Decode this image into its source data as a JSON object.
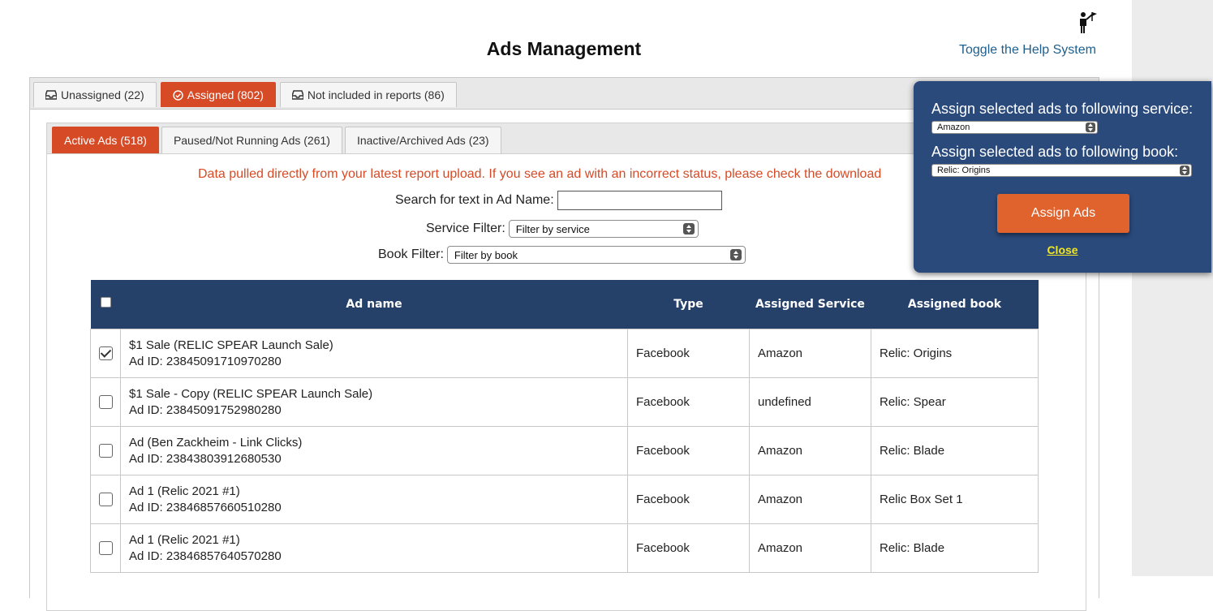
{
  "page": {
    "title": "Ads Management",
    "help_link": "Toggle the Help System"
  },
  "outer_tabs": [
    {
      "label": "Unassigned (22)",
      "icon": "inbox-icon",
      "active": false
    },
    {
      "label": "Assigned (802)",
      "icon": "check-circle-icon",
      "active": true
    },
    {
      "label": "Not included in reports (86)",
      "icon": "inbox-icon",
      "active": false
    }
  ],
  "inner_tabs": [
    {
      "label": "Active Ads (518)",
      "active": true
    },
    {
      "label": "Paused/Not Running Ads (261)",
      "active": false
    },
    {
      "label": "Inactive/Archived Ads (23)",
      "active": false
    }
  ],
  "notice": "Data pulled directly from your latest report upload. If you see an ad with an incorrect status, please check the download",
  "filters": {
    "search_label": "Search for text in Ad Name:",
    "search_value": "",
    "service_label": "Service Filter:",
    "service_value": "Filter by service",
    "book_label": "Book Filter:",
    "book_value": "Filter by book"
  },
  "table": {
    "columns": [
      "Ad name",
      "Type",
      "Assigned Service",
      "Assigned book"
    ],
    "rows": [
      {
        "checked": true,
        "name": "$1 Sale (RELIC SPEAR Launch Sale)",
        "ad_id": "Ad ID: 23845091710970280",
        "type": "Facebook",
        "service": "Amazon",
        "book": "Relic: Origins"
      },
      {
        "checked": false,
        "name": "$1 Sale - Copy (RELIC SPEAR Launch Sale)",
        "ad_id": "Ad ID: 23845091752980280",
        "type": "Facebook",
        "service": "undefined",
        "book": "Relic: Spear"
      },
      {
        "checked": false,
        "name": "Ad (Ben Zackheim - Link Clicks)",
        "ad_id": "Ad ID: 23843803912680530",
        "type": "Facebook",
        "service": "Amazon",
        "book": "Relic: Blade"
      },
      {
        "checked": false,
        "name": "Ad 1 (Relic 2021 #1)",
        "ad_id": "Ad ID: 23846857660510280",
        "type": "Facebook",
        "service": "Amazon",
        "book": "Relic Box Set 1"
      },
      {
        "checked": false,
        "name": "Ad 1 (Relic 2021 #1)",
        "ad_id": "Ad ID: 23846857640570280",
        "type": "Facebook",
        "service": "Amazon",
        "book": "Relic: Blade"
      }
    ]
  },
  "assign_popup": {
    "service_label": "Assign selected ads to following service:",
    "service_value": "Amazon",
    "book_label": "Assign selected ads to following book:",
    "book_value": "Relic: Origins",
    "assign_button": "Assign Ads",
    "close_link": "Close"
  },
  "colors": {
    "accent": "#d64a26",
    "header_navy": "#25416a",
    "popup_blue": "#2a4a7c",
    "button_orange": "#e0622c",
    "close_yellow": "#f3e623",
    "link_blue": "#1d5f8e"
  }
}
